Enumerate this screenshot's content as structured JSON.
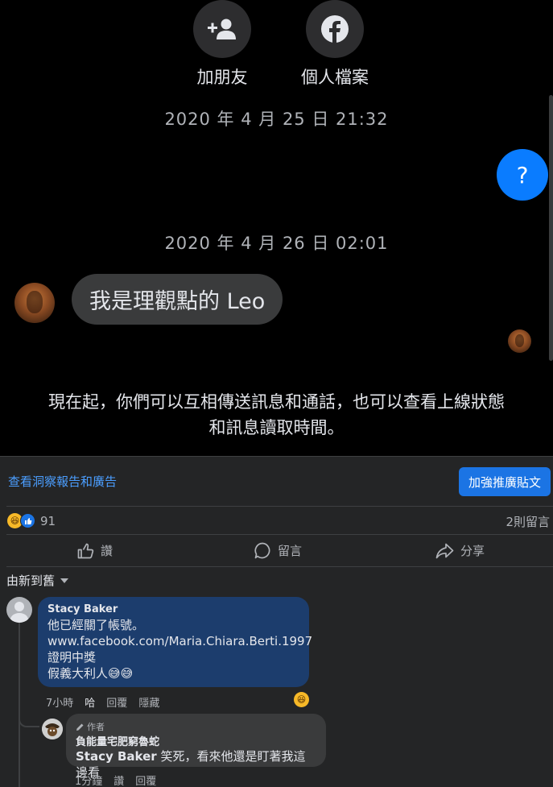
{
  "messenger": {
    "actions": [
      {
        "label": "加朋友",
        "icon": "add-friend-icon"
      },
      {
        "label": "個人檔案",
        "icon": "facebook-icon"
      }
    ],
    "timestamps": [
      "2020 年 4 月 25 日 21:32",
      "2020 年 4 月 26 日 02:01"
    ],
    "question_bubble": "?",
    "incoming_message": "我是理觀點的 Leo",
    "info_text_line1": "現在起，你們可以互相傳送訊息和通話，也可以查看上線狀態",
    "info_text_line2": "和訊息讀取時間。",
    "accent_color": "#0a7cff"
  },
  "post": {
    "insights_link": "查看洞察報告和廣告",
    "boost_button": "加強推廣貼文",
    "reaction_count": "91",
    "comment_count": "2則留言",
    "actions": {
      "like": "讚",
      "comment": "留言",
      "share": "分享"
    },
    "sort_label": "由新到舊",
    "comments": [
      {
        "author": "Stacy Baker",
        "lines": [
          "他已經關了帳號。",
          "www.facebook.com/Maria.Chiara.Berti.1997",
          "證明中獎",
          "假義大利人😅😅"
        ],
        "time": "7小時",
        "reaction": "哈",
        "reply": "回覆",
        "hide": "隱藏"
      },
      {
        "author_tag": "作者",
        "author": "負能量宅肥窮魯蛇",
        "mention": "Stacy Baker",
        "text": " 笑死，看來他還是盯著我這邊看",
        "time": "1分鐘",
        "like": "讚",
        "reply": "回覆"
      }
    ],
    "brand_color": "#1b74e4"
  }
}
